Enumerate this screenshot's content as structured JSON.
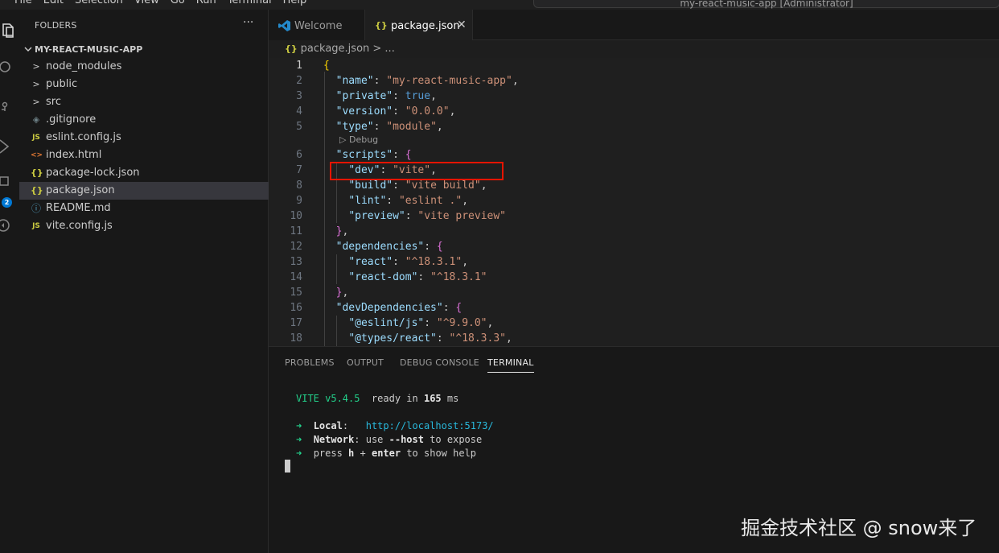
{
  "menubar": {
    "items": [
      "File",
      "Edit",
      "Selection",
      "View",
      "Go",
      "Run",
      "Terminal",
      "Help"
    ],
    "title": "my-react-music-app [Administrator]"
  },
  "activity": {
    "badge": "2"
  },
  "sidebar": {
    "header": "FOLDERS",
    "more": "···",
    "root": "MY-REACT-MUSIC-APP",
    "items": [
      {
        "name": "node_modules",
        "icon": ">"
      },
      {
        "name": "public",
        "icon": ">"
      },
      {
        "name": "src",
        "icon": ">"
      },
      {
        "name": ".gitignore",
        "icon": "◈"
      },
      {
        "name": "eslint.config.js",
        "icon": "JS"
      },
      {
        "name": "index.html",
        "icon": "<>"
      },
      {
        "name": "package-lock.json",
        "icon": "{}"
      },
      {
        "name": "package.json",
        "icon": "{}"
      },
      {
        "name": "README.md",
        "icon": "ⓘ"
      },
      {
        "name": "vite.config.js",
        "icon": "JS"
      }
    ]
  },
  "tabs": {
    "welcome": "Welcome",
    "package": "package.json",
    "close": "✕"
  },
  "breadcrumb": {
    "icon": "{}",
    "file": "package.json",
    "rest": " > ..."
  },
  "editor": {
    "codelens": "Debug",
    "lines": [
      {
        "n": "1"
      },
      {
        "n": "2"
      },
      {
        "n": "3"
      },
      {
        "n": "4"
      },
      {
        "n": "5"
      },
      {
        "n": "6"
      },
      {
        "n": "7"
      },
      {
        "n": "8"
      },
      {
        "n": "9"
      },
      {
        "n": "10"
      },
      {
        "n": "11"
      },
      {
        "n": "12"
      },
      {
        "n": "13"
      },
      {
        "n": "14"
      },
      {
        "n": "15"
      },
      {
        "n": "16"
      },
      {
        "n": "17"
      },
      {
        "n": "18"
      }
    ],
    "tokens": {
      "name_key": "\"name\"",
      "name_val": "\"my-react-music-app\"",
      "private_key": "\"private\"",
      "private_val": "true",
      "version_key": "\"version\"",
      "version_val": "\"0.0.0\"",
      "type_key": "\"type\"",
      "type_val": "\"module\"",
      "scripts_key": "\"scripts\"",
      "dev_key": "\"dev\"",
      "dev_val": "\"vite\"",
      "build_key": "\"build\"",
      "build_val": "\"vite build\"",
      "lint_key": "\"lint\"",
      "lint_val": "\"eslint .\"",
      "preview_key": "\"preview\"",
      "preview_val": "\"vite preview\"",
      "deps_key": "\"dependencies\"",
      "react_key": "\"react\"",
      "react_val": "\"^18.3.1\"",
      "reactdom_key": "\"react-dom\"",
      "reactdom_val": "\"^18.3.1\"",
      "devdeps_key": "\"devDependencies\"",
      "eslintjs_key": "\"@eslint/js\"",
      "eslintjs_val": "\"^9.9.0\"",
      "typesreact_key": "\"@types/react\"",
      "typesreact_val": "\"^18.3.3\""
    }
  },
  "panel": {
    "tabs": [
      "PROBLEMS",
      "OUTPUT",
      "DEBUG CONSOLE",
      "TERMINAL"
    ],
    "terminal": {
      "vite": "VITE",
      "version": " v5.4.5",
      "ready": "  ready in ",
      "ms": "165",
      "ms_unit": " ms",
      "arrow": "➜",
      "local_label": "Local",
      "local_colon": ":   ",
      "local_url": "http://localhost:5173/",
      "network_label": "Network",
      "network_text1": ": use ",
      "network_flag": "--host",
      "network_text2": " to expose",
      "help_text1": "press ",
      "help_h": "h",
      "help_plus": " + ",
      "help_enter": "enter",
      "help_text2": " to show help"
    }
  },
  "watermark": "掘金技术社区 @ snow来了"
}
